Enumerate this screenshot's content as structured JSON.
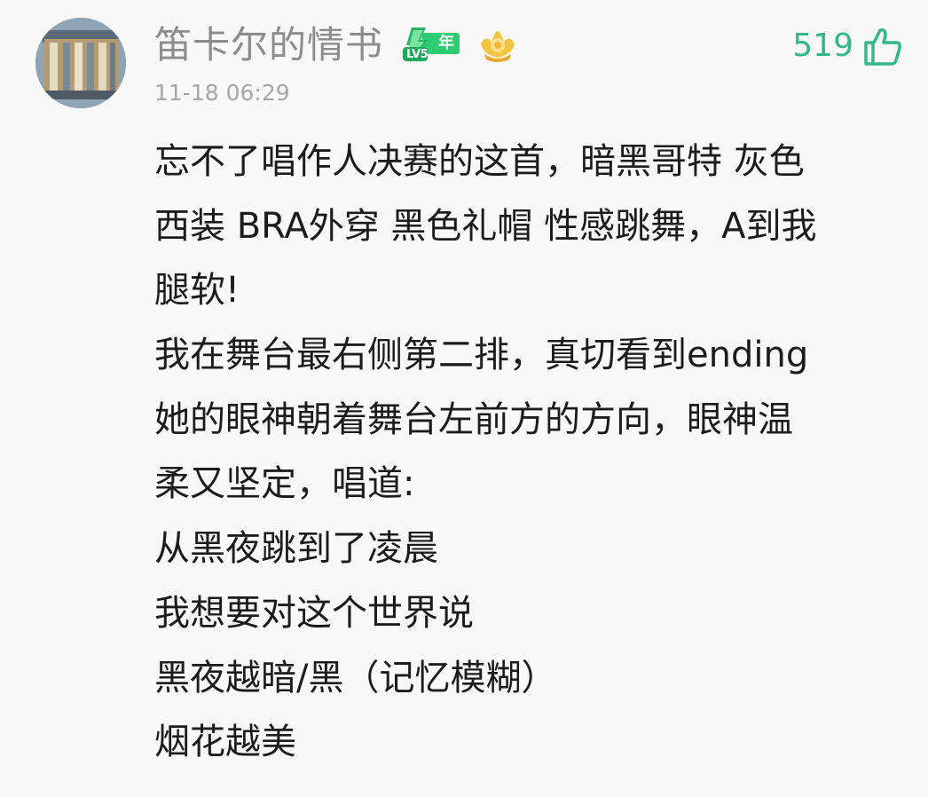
{
  "comment": {
    "username": "笛卡尔的情书",
    "badge": {
      "year_label": "年",
      "level_label": "LV5",
      "color": "#2ecc71"
    },
    "medal_icon": "gold-crown-medal-icon",
    "timestamp": "11-18 06:29",
    "like_count": "519",
    "like_icon": "thumbs-up-icon",
    "accent_color": "#33b889",
    "body_lines": [
      "忘不了唱作人决赛的这首，暗黑哥特 灰色",
      "西装 BRA外穿 黑色礼帽 性感跳舞，A到我",
      "腿软!",
      "我在舞台最右侧第二排，真切看到ending",
      "她的眼神朝着舞台左前方的方向，眼神温",
      "柔又坚定，唱道:",
      "从黑夜跳到了凌晨",
      "我想要对这个世界说",
      "黑夜越暗/黑（记忆模糊）",
      "烟花越美"
    ]
  }
}
